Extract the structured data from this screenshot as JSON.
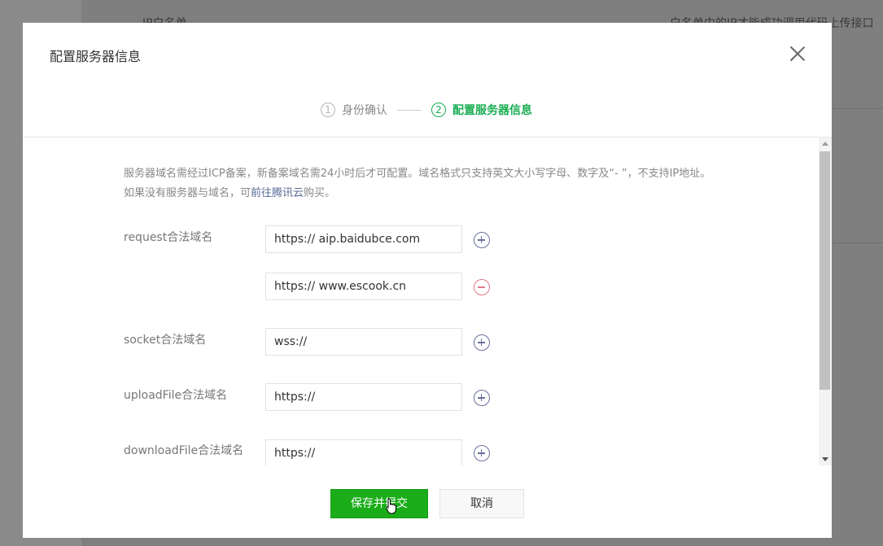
{
  "background": {
    "left_text": "IP白名单",
    "right_text": "白名单中的IP才能成功调用代码上传接口"
  },
  "modal": {
    "title": "配置服务器信息",
    "close_label": "×"
  },
  "steps": [
    {
      "num": "1",
      "label": "身份确认",
      "active": false
    },
    {
      "num": "2",
      "label": "配置服务器信息",
      "active": true
    }
  ],
  "notice": {
    "text_before": "服务器域名需经过ICP备案，新备案域名需24小时后才可配置。域名格式只支持英文大小写字母、数字及“- ”，不支持IP地址。如果没有服务器与域名，可",
    "link": "前往腾讯云",
    "text_after": "购买。"
  },
  "fields": {
    "request": {
      "label": "request合法域名",
      "values": [
        "https:// aip.baidubce.com",
        "https:// www.escook.cn"
      ]
    },
    "socket": {
      "label": "socket合法域名",
      "value": "wss://"
    },
    "upload": {
      "label": "uploadFile合法域名",
      "value": "https://"
    },
    "download": {
      "label": "downloadFile合法域名",
      "value": "https://"
    }
  },
  "buttons": {
    "save": "保存并提交",
    "cancel": "取消"
  },
  "colors": {
    "accent_green": "#1aad19",
    "step_active": "#1aad53",
    "link": "#576b95",
    "add_icon": "#6b6f9b",
    "remove_icon": "#e07a8a"
  },
  "icons": [
    "close-icon",
    "add-circle-icon",
    "remove-circle-icon",
    "pointer-cursor-icon"
  ]
}
